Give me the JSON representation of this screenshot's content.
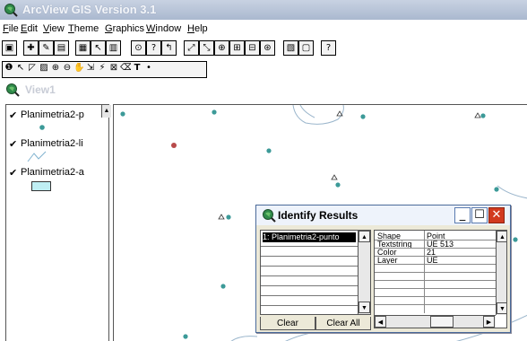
{
  "app": {
    "title": "ArcView GIS Version 3.1"
  },
  "menu": [
    "File",
    "Edit",
    "View",
    "Theme",
    "Graphics",
    "Window",
    "Help"
  ],
  "view": {
    "title": "View1"
  },
  "legend": {
    "items": [
      {
        "name": "Planimetria2-p",
        "checked": true,
        "symbol": "point"
      },
      {
        "name": "Planimetria2-li",
        "checked": true,
        "symbol": "line"
      },
      {
        "name": "Planimetria2-a",
        "checked": true,
        "symbol": "polygon"
      }
    ]
  },
  "identify": {
    "title": "Identify Results",
    "features": [
      "1: Planimetria2-punto"
    ],
    "attributes": [
      {
        "field": "Shape",
        "value": "Point"
      },
      {
        "field": "Textstring",
        "value": "UE 513"
      },
      {
        "field": "Color",
        "value": "21"
      },
      {
        "field": "Layer",
        "value": "UE"
      }
    ],
    "clear_label": "Clear",
    "clear_all_label": "Clear All"
  },
  "toolbar2": {
    "text_tool": "T"
  },
  "colors": {
    "point": "#3c9a98",
    "selected_point": "#b84a4a",
    "lines": "#9bb6cc",
    "polygon_fill": "#bfeff4"
  }
}
